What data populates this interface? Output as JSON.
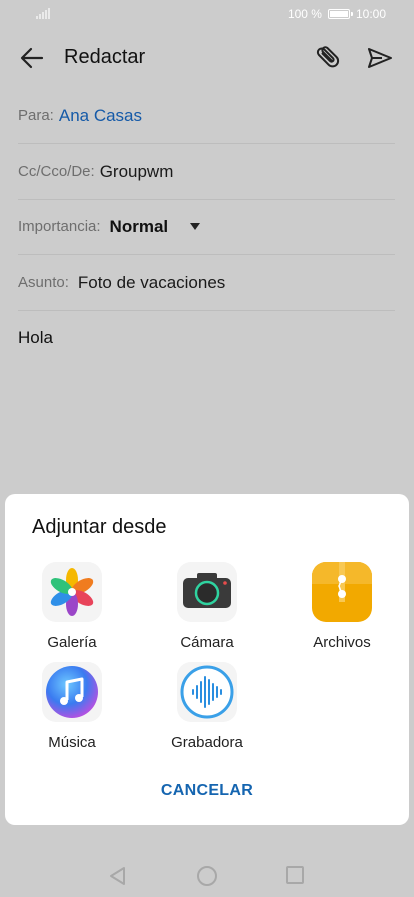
{
  "status_bar": {
    "battery_text": "100 %",
    "time": "10:00"
  },
  "app_bar": {
    "title": "Redactar",
    "icons": [
      "back-arrow-icon",
      "paperclip-icon",
      "send-icon"
    ]
  },
  "form": {
    "to": {
      "label": "Para:",
      "value": "Ana Casas"
    },
    "cc": {
      "label": "Cc/Cco/De:",
      "value": "Groupwm"
    },
    "importance": {
      "label": "Importancia:",
      "value": "Normal"
    },
    "subject": {
      "label": "Asunto:",
      "value": "Foto de vacaciones"
    },
    "body": "Hola"
  },
  "sheet": {
    "title": "Adjuntar desde",
    "options": [
      {
        "label": "Galería",
        "icon": "gallery-icon"
      },
      {
        "label": "Cámara",
        "icon": "camera-icon"
      },
      {
        "label": "Archivos",
        "icon": "files-icon"
      },
      {
        "label": "Música",
        "icon": "music-icon"
      },
      {
        "label": "Grabadora",
        "icon": "recorder-icon"
      }
    ],
    "cancel_label": "CANCELAR"
  },
  "colors": {
    "accent": "#1565b0",
    "to_name": "#155aa8",
    "scrim_bg": "#cccccc",
    "files_icon": "#f2a900"
  }
}
